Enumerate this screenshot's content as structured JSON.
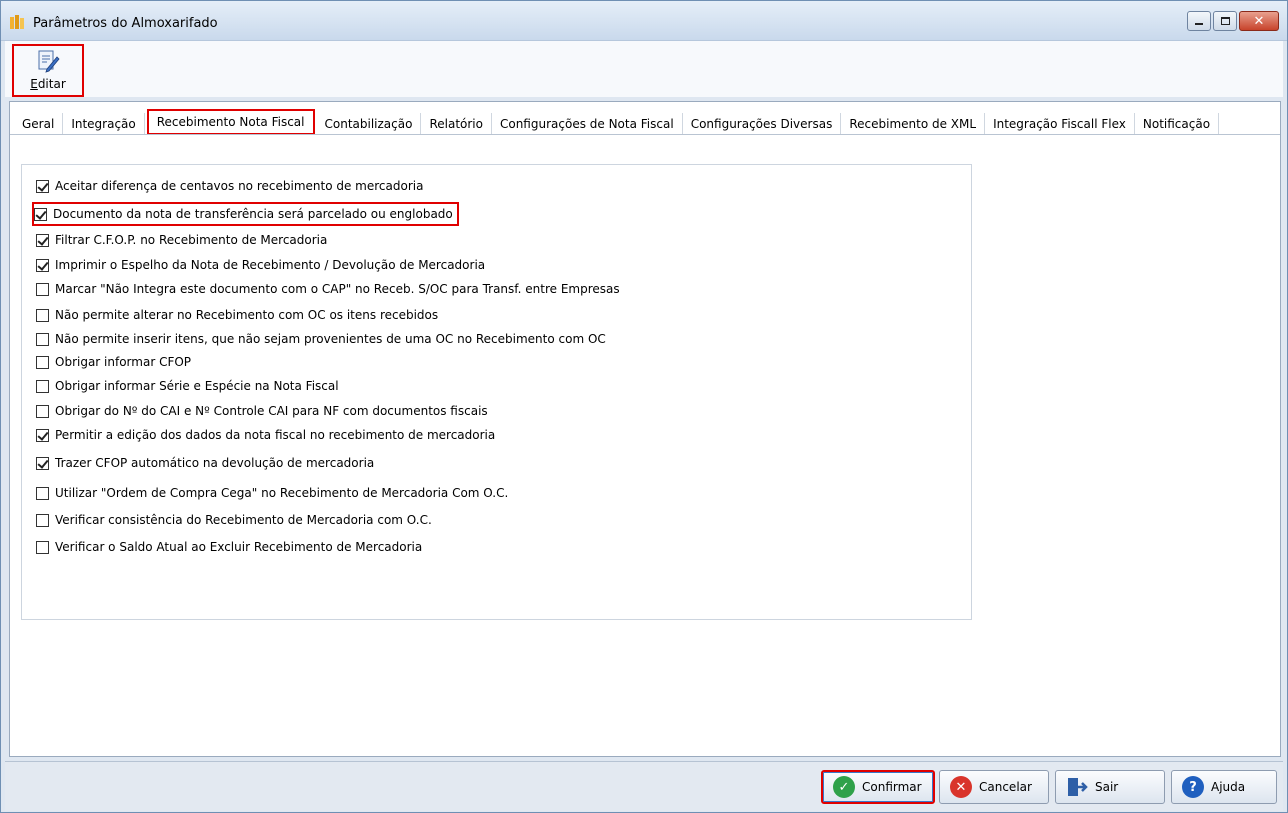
{
  "window": {
    "title": "Parâmetros do Almoxarifado"
  },
  "toolbar": {
    "edit_label": "Editar"
  },
  "tabs": [
    {
      "label": "Geral"
    },
    {
      "label": "Integração"
    },
    {
      "label": "Recebimento Nota Fiscal"
    },
    {
      "label": "Contabilização"
    },
    {
      "label": "Relatório"
    },
    {
      "label": "Configurações de Nota Fiscal"
    },
    {
      "label": "Configurações Diversas"
    },
    {
      "label": "Recebimento de XML"
    },
    {
      "label": "Integração Fiscall Flex"
    },
    {
      "label": "Notificação"
    }
  ],
  "active_tab": "Recebimento Nota Fiscal",
  "options": [
    {
      "label": "Aceitar diferença de centavos no recebimento de mercadoria",
      "checked": true
    },
    {
      "label": "Documento da nota de transferência será parcelado ou englobado",
      "checked": true
    },
    {
      "label": "Filtrar C.F.O.P. no Recebimento de Mercadoria",
      "checked": true
    },
    {
      "label": "Imprimir o Espelho da Nota de Recebimento / Devolução de Mercadoria",
      "checked": true
    },
    {
      "label": "Marcar \"Não Integra este documento com o CAP\" no Receb. S/OC para Transf. entre Empresas",
      "checked": false
    },
    {
      "label": "Não permite alterar no Recebimento com OC os itens recebidos",
      "checked": false
    },
    {
      "label": "Não permite inserir itens, que não sejam provenientes de uma OC no Recebimento com OC",
      "checked": false
    },
    {
      "label": "Obrigar informar CFOP",
      "checked": false
    },
    {
      "label": "Obrigar informar Série e Espécie na Nota Fiscal",
      "checked": false
    },
    {
      "label": "Obrigar do Nº do CAI e Nº Controle CAI para NF com documentos fiscais",
      "checked": false
    },
    {
      "label": "Permitir a edição dos dados da nota fiscal no recebimento de mercadoria",
      "checked": true
    },
    {
      "label": "Trazer CFOP automático na devolução de mercadoria",
      "checked": true
    },
    {
      "label": "Utilizar \"Ordem de Compra Cega\" no Recebimento de Mercadoria Com O.C.",
      "checked": false
    },
    {
      "label": "Verificar consistência do Recebimento de Mercadoria com O.C.",
      "checked": false
    },
    {
      "label": "Verificar o Saldo Atual ao Excluir Recebimento de Mercadoria",
      "checked": false
    }
  ],
  "buttons": {
    "confirm": "Confirmar",
    "cancel": "Cancelar",
    "exit": "Sair",
    "help": "Ajuda"
  }
}
